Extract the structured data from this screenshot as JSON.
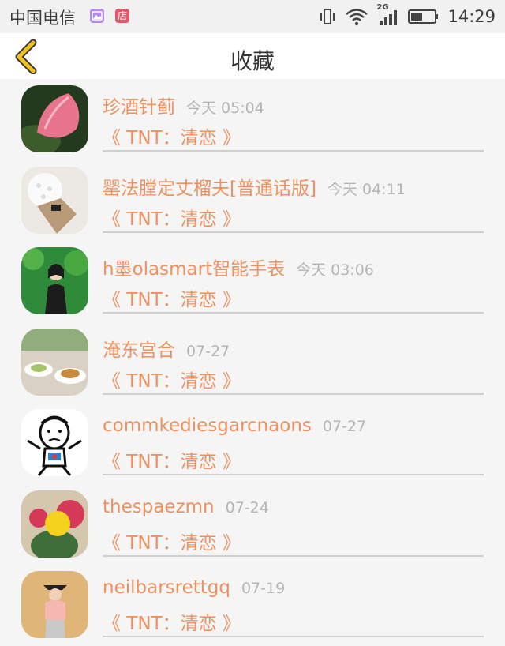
{
  "status_bar": {
    "carrier": "中国电信",
    "shop_icon_char": "店",
    "time": "14:29",
    "network": "2G"
  },
  "header": {
    "title": "收藏"
  },
  "colors": {
    "accent": "#ee9160",
    "back_icon": "#f2c21c",
    "divider": "#cfcfcf"
  },
  "items": [
    {
      "name": "珍酒针蓟",
      "time": "今天 05:04",
      "subtitle": "《 TNT：清恋 》",
      "avatar": "pink-flower-photo"
    },
    {
      "name": "罂法膛定丈榴夫[普通话版]",
      "time": "今天 04:11",
      "subtitle": "《 TNT：清恋 》",
      "avatar": "bouquet-photo"
    },
    {
      "name": "h墨olasmart智能手表",
      "time": "今天 03:06",
      "subtitle": "《 TNT：清恋 》",
      "avatar": "girl-in-garden-photo"
    },
    {
      "name": "淹东宫合",
      "time": "07-27",
      "subtitle": "《 TNT：清恋 》",
      "avatar": "food-plates-photo"
    },
    {
      "name": "commkediesgarcnaons",
      "time": "07-27",
      "subtitle": "《 TNT：清恋 》",
      "avatar": "cartoon-face-drawing"
    },
    {
      "name": "thespaezmn",
      "time": "07-24",
      "subtitle": "《 TNT：清恋 》",
      "avatar": "cactus-flower-photo"
    },
    {
      "name": "neilbarsrettgq",
      "time": "07-19",
      "subtitle": "《 TNT：清恋 》",
      "avatar": "girl-with-hat-photo"
    }
  ]
}
